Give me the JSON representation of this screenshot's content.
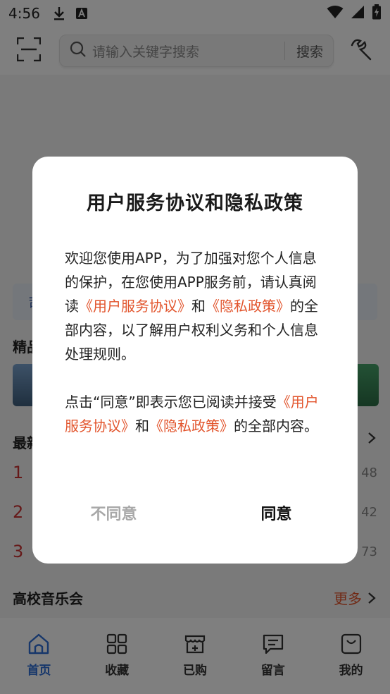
{
  "status_bar": {
    "time": "4:56",
    "icons": [
      "download-icon",
      "a-icon",
      "wifi-icon",
      "signal-icon",
      "battery-charging-icon"
    ]
  },
  "header": {
    "search_placeholder": "请输入关键字搜索",
    "search_button": "搜索"
  },
  "background_content": {
    "sections": [
      {
        "title": "精品"
      },
      {
        "title": "最新",
        "more_chevron": true
      },
      {
        "title": "高校音乐会",
        "more": "更多"
      }
    ],
    "notice_prefix": "司",
    "rank_list": [
      {
        "rank": "1",
        "count": "48"
      },
      {
        "rank": "2",
        "count": "42"
      },
      {
        "rank": "3",
        "count": "73"
      }
    ]
  },
  "tabs": [
    {
      "label": "首页",
      "icon": "home-icon",
      "active": true
    },
    {
      "label": "收藏",
      "icon": "grid-icon",
      "active": false
    },
    {
      "label": "已购",
      "icon": "cart-icon",
      "active": false
    },
    {
      "label": "留言",
      "icon": "message-icon",
      "active": false
    },
    {
      "label": "我的",
      "icon": "bag-icon",
      "active": false
    }
  ],
  "dialog": {
    "title": "用户服务协议和隐私政策",
    "para1": {
      "before": "欢迎您使用APP，为了加强对您个人信息的保护，在您使用APP服务前，请认真阅读",
      "link1": "《用户服务协议》",
      "middle": "和",
      "link2": "《隐私政策》",
      "after": "的全部内容，以了解用户权利义务和个人信息处理规则。"
    },
    "para2": {
      "before": "点击“同意”即表示您已阅读并接受",
      "link1": "《用户服务协议》",
      "middle": "和",
      "link2": "《隐私政策》",
      "after": "的全部内容。"
    },
    "disagree_button": "不同意",
    "agree_button": "同意"
  },
  "colors": {
    "link": "#e2552d",
    "tab_active": "#2f6fd6",
    "overlay": "rgba(0,0,0,0.5)"
  }
}
